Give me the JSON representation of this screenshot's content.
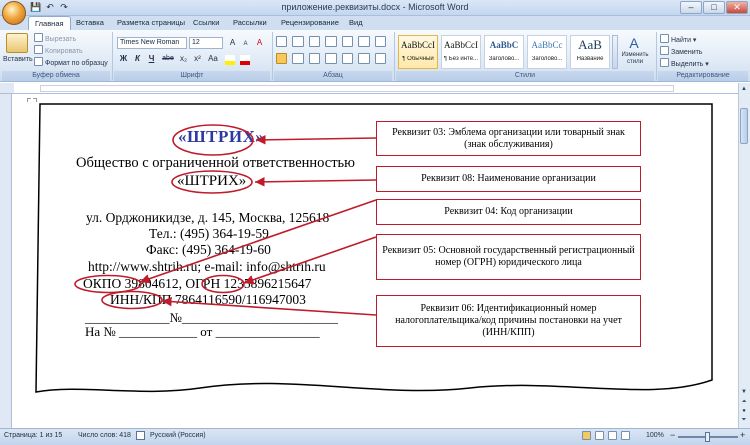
{
  "window": {
    "title": "приложение.реквизиты.docx - Microsoft Word",
    "minimize": "–",
    "maximize": "□",
    "close": "✕"
  },
  "quick_access": {
    "save": "💾",
    "undo": "↶",
    "redo": "↷"
  },
  "tabs": [
    {
      "label": "Главная",
      "active": true
    },
    {
      "label": "Вставка"
    },
    {
      "label": "Разметка страницы"
    },
    {
      "label": "Ссылки"
    },
    {
      "label": "Рассылки"
    },
    {
      "label": "Рецензирование"
    },
    {
      "label": "Вид"
    }
  ],
  "ribbon": {
    "clipboard": {
      "label": "Буфер обмена",
      "paste": "Вставить",
      "cut": "Вырезать",
      "copy": "Копировать",
      "format_painter": "Формат по образцу"
    },
    "font": {
      "label": "Шрифт",
      "family": "Times New Roman",
      "size": "12",
      "bold": "Ж",
      "italic": "К",
      "underline": "Ч",
      "strike": "abe",
      "sub": "x₂",
      "sup": "x²",
      "case": "Aa",
      "grow": "A",
      "shrink": "A",
      "clear": "A"
    },
    "paragraph": {
      "label": "Абзац"
    },
    "styles": {
      "label": "Стили",
      "items": [
        {
          "sample": "AaBbCcI",
          "name": "¶ Обычный",
          "selected": true
        },
        {
          "sample": "AaBbCcI",
          "name": "¶ Без инте..."
        },
        {
          "sample": "AaBbC",
          "name": "Заголово..."
        },
        {
          "sample": "AaBbCc",
          "name": "Заголово..."
        },
        {
          "sample": "AaB",
          "name": "Название"
        }
      ],
      "change": "Изменить стили"
    },
    "editing": {
      "label": "Редактирование",
      "find": "Найти",
      "replace": "Заменить",
      "select": "Выделить"
    }
  },
  "document": {
    "logo": "«ШТРИХ»",
    "line1": "Общество с ограниченной ответственностью",
    "line2": "«ШТРИХ»",
    "address": "ул. Орджоникидзе, д. 145, Москва, 125618",
    "phone": "Тел.: (495) 364-19-59",
    "fax": "Факс:  (495) 364-19-60",
    "web": "http://www.shtrih.ru; e-mail: info@shtrih.ru",
    "okpo": "ОКПО 39804612, ОГРН 1235896215647",
    "inn": "ИНН/КПП 7864116590/116947003",
    "line_no": "_____________№________________________",
    "line_ref": "На № ____________ от ________________"
  },
  "callouts": [
    "Реквизит 03: Эмблема организации или товарный знак (знак обслуживания)",
    "Реквизит 08: Наименование организации",
    "Реквизит 04: Код организации",
    "Реквизит 05: Основной государственный регистрационный номер (ОГРН) юридического лица",
    "Реквизит 06: Идентификационный номер налогоплательщика/код причины постановки на учет (ИНН/КПП)"
  ],
  "status": {
    "page": "Страница: 1 из 15",
    "words": "Число слов: 418",
    "lang": "Русский (Россия)",
    "zoom": "100%"
  }
}
